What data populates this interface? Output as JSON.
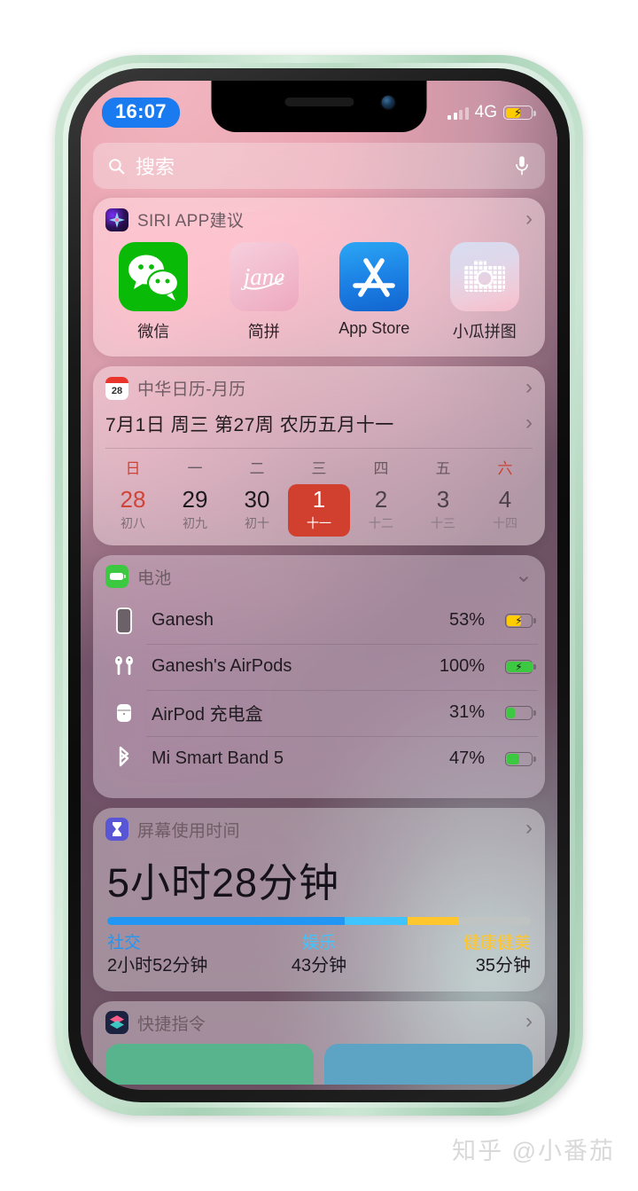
{
  "status_bar": {
    "time": "16:07",
    "network": "4G",
    "signal_bars_filled": 2,
    "signal_bars_total": 4,
    "battery_percent": 53,
    "battery_charging": true,
    "battery_color": "#ffcc00",
    "time_pill_color": "#1a7bf0"
  },
  "search": {
    "placeholder": "搜索",
    "search_icon": "search-icon",
    "mic_icon": "microphone-icon"
  },
  "widgets": {
    "siri": {
      "title": "SIRI APP建议",
      "chevron": "›",
      "apps": [
        {
          "label": "微信",
          "icon": "wechat-icon",
          "color": "#09bb07"
        },
        {
          "label": "简拼",
          "icon": "jane-icon",
          "color": "#f2bed0"
        },
        {
          "label": "App Store",
          "icon": "app-store-icon",
          "color": "#1b7fe3"
        },
        {
          "label": "小瓜拼图",
          "icon": "puzzle-camera-icon",
          "color": "#e6d3e2"
        }
      ]
    },
    "calendar": {
      "title": "中华日历-月历",
      "chevron": "›",
      "date_line": "7月1日  周三  第27周  农历五月十一",
      "row_chevron": "›",
      "weekdays": [
        "日",
        "一",
        "二",
        "三",
        "四",
        "五",
        "六"
      ],
      "days": [
        {
          "num": "28",
          "lunar": "初八",
          "weekend": true,
          "today": false,
          "future": false
        },
        {
          "num": "29",
          "lunar": "初九",
          "weekend": false,
          "today": false,
          "future": false
        },
        {
          "num": "30",
          "lunar": "初十",
          "weekend": false,
          "today": false,
          "future": false
        },
        {
          "num": "1",
          "lunar": "十一",
          "weekend": false,
          "today": true,
          "future": false
        },
        {
          "num": "2",
          "lunar": "十二",
          "weekend": false,
          "today": false,
          "future": true
        },
        {
          "num": "3",
          "lunar": "十三",
          "weekend": false,
          "today": false,
          "future": true
        },
        {
          "num": "4",
          "lunar": "十四",
          "weekend": true,
          "today": false,
          "future": true
        }
      ],
      "today_color": "#d1402f"
    },
    "battery": {
      "title": "电池",
      "chevron": "⌄",
      "icon_color": "#3cc840",
      "devices": [
        {
          "name": "Ganesh",
          "percent": "53%",
          "level": 53,
          "charging": true,
          "color": "#ffcc00",
          "icon": "iphone-icon"
        },
        {
          "name": "Ganesh's AirPods",
          "percent": "100%",
          "level": 100,
          "charging": true,
          "color": "#3cc840",
          "icon": "airpods-icon"
        },
        {
          "name": "AirPod 充电盒",
          "percent": "31%",
          "level": 31,
          "charging": false,
          "color": "#3cc840",
          "icon": "airpods-case-icon"
        },
        {
          "name": "Mi Smart Band 5",
          "percent": "47%",
          "level": 47,
          "charging": false,
          "color": "#3cc840",
          "icon": "bluetooth-icon"
        }
      ]
    },
    "screen_time": {
      "title": "屏幕使用时间",
      "chevron": "›",
      "total": "5小时28分钟",
      "icon": "hourglass-icon",
      "icon_color": "#5856d6",
      "categories": [
        {
          "name": "社交",
          "value": "2小时52分钟",
          "color": "#2196f3",
          "pct": 56
        },
        {
          "name": "娱乐",
          "value": "43分钟",
          "color": "#40c4ff",
          "pct": 15
        },
        {
          "name": "健康健美",
          "value": "35分钟",
          "color": "#ffc62e",
          "pct": 12
        },
        {
          "name": "",
          "value": "",
          "color": "#bfc4c2",
          "pct": 17
        }
      ]
    },
    "shortcuts": {
      "title": "快捷指令",
      "chevron": "›",
      "icon": "shortcuts-icon",
      "tiles": [
        {
          "color": "#57b48d"
        },
        {
          "color": "#5ca3c4"
        }
      ]
    }
  },
  "watermark": "知乎 @小番茄"
}
